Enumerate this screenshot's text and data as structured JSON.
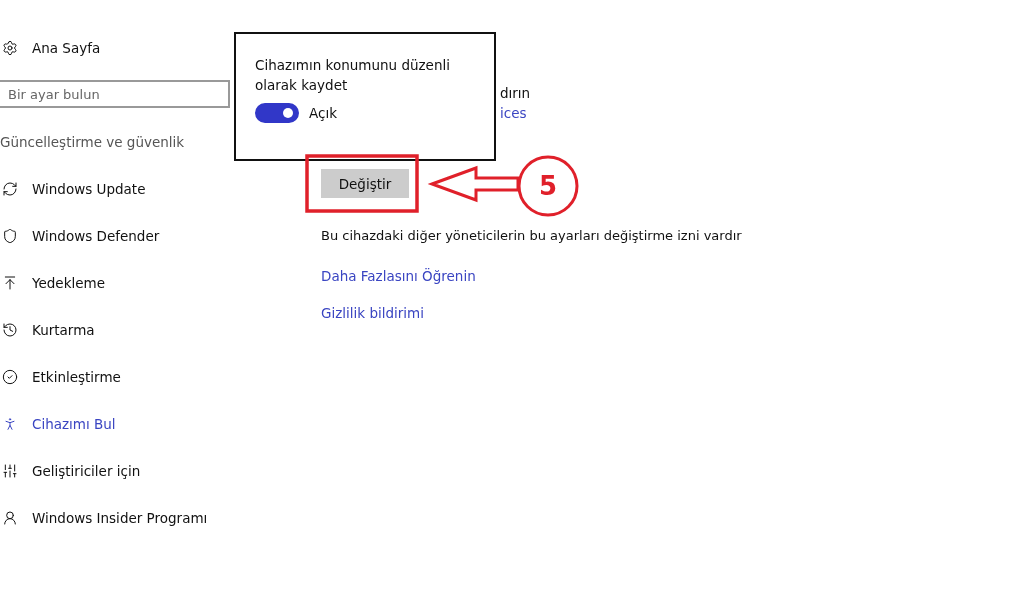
{
  "sidebar": {
    "home": {
      "label": "Ana Sayfa"
    },
    "search": {
      "placeholder": "Bir ayar bulun"
    },
    "section_title": "Güncelleştirme ve güvenlik",
    "items": [
      {
        "label": "Windows Update",
        "kind": "update",
        "selected": false
      },
      {
        "label": "Windows Defender",
        "kind": "shield",
        "selected": false
      },
      {
        "label": "Yedekleme",
        "kind": "backup",
        "selected": false
      },
      {
        "label": "Kurtarma",
        "kind": "recovery",
        "selected": false
      },
      {
        "label": "Etkinleştirme",
        "kind": "activation",
        "selected": false
      },
      {
        "label": "Cihazımı Bul",
        "kind": "find",
        "selected": true
      },
      {
        "label": "Geliştiriciler için",
        "kind": "developer",
        "selected": false
      },
      {
        "label": "Windows Insider Programı",
        "kind": "insider",
        "selected": false
      }
    ]
  },
  "content": {
    "partial_text": "dırın",
    "partial_link": "ices",
    "change_button": "Değiştir",
    "note": "Bu cihazdaki diğer yöneticilerin bu ayarları değiştirme izni vardır",
    "links": [
      "Daha Fazlasını Öğrenin",
      "Gizlilik bildirimi"
    ]
  },
  "popup": {
    "title": "Cihazımın konumunu düzenli olarak kaydet",
    "toggle": {
      "on": true,
      "label": "Açık"
    }
  },
  "annotation": {
    "step": "5"
  }
}
